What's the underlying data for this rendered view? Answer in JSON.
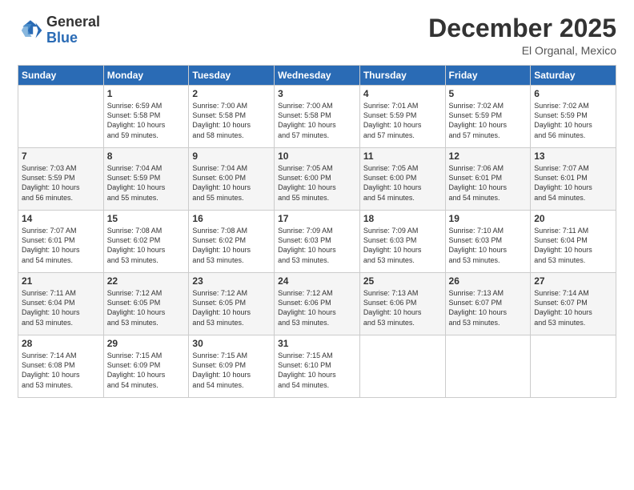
{
  "header": {
    "logo": {
      "line1": "General",
      "line2": "Blue"
    },
    "title": "December 2025",
    "location": "El Organal, Mexico"
  },
  "days_of_week": [
    "Sunday",
    "Monday",
    "Tuesday",
    "Wednesday",
    "Thursday",
    "Friday",
    "Saturday"
  ],
  "weeks": [
    [
      {
        "day": "",
        "info": ""
      },
      {
        "day": "1",
        "info": "Sunrise: 6:59 AM\nSunset: 5:58 PM\nDaylight: 10 hours\nand 59 minutes."
      },
      {
        "day": "2",
        "info": "Sunrise: 7:00 AM\nSunset: 5:58 PM\nDaylight: 10 hours\nand 58 minutes."
      },
      {
        "day": "3",
        "info": "Sunrise: 7:00 AM\nSunset: 5:58 PM\nDaylight: 10 hours\nand 57 minutes."
      },
      {
        "day": "4",
        "info": "Sunrise: 7:01 AM\nSunset: 5:59 PM\nDaylight: 10 hours\nand 57 minutes."
      },
      {
        "day": "5",
        "info": "Sunrise: 7:02 AM\nSunset: 5:59 PM\nDaylight: 10 hours\nand 57 minutes."
      },
      {
        "day": "6",
        "info": "Sunrise: 7:02 AM\nSunset: 5:59 PM\nDaylight: 10 hours\nand 56 minutes."
      }
    ],
    [
      {
        "day": "7",
        "info": "Sunrise: 7:03 AM\nSunset: 5:59 PM\nDaylight: 10 hours\nand 56 minutes."
      },
      {
        "day": "8",
        "info": "Sunrise: 7:04 AM\nSunset: 5:59 PM\nDaylight: 10 hours\nand 55 minutes."
      },
      {
        "day": "9",
        "info": "Sunrise: 7:04 AM\nSunset: 6:00 PM\nDaylight: 10 hours\nand 55 minutes."
      },
      {
        "day": "10",
        "info": "Sunrise: 7:05 AM\nSunset: 6:00 PM\nDaylight: 10 hours\nand 55 minutes."
      },
      {
        "day": "11",
        "info": "Sunrise: 7:05 AM\nSunset: 6:00 PM\nDaylight: 10 hours\nand 54 minutes."
      },
      {
        "day": "12",
        "info": "Sunrise: 7:06 AM\nSunset: 6:01 PM\nDaylight: 10 hours\nand 54 minutes."
      },
      {
        "day": "13",
        "info": "Sunrise: 7:07 AM\nSunset: 6:01 PM\nDaylight: 10 hours\nand 54 minutes."
      }
    ],
    [
      {
        "day": "14",
        "info": "Sunrise: 7:07 AM\nSunset: 6:01 PM\nDaylight: 10 hours\nand 54 minutes."
      },
      {
        "day": "15",
        "info": "Sunrise: 7:08 AM\nSunset: 6:02 PM\nDaylight: 10 hours\nand 53 minutes."
      },
      {
        "day": "16",
        "info": "Sunrise: 7:08 AM\nSunset: 6:02 PM\nDaylight: 10 hours\nand 53 minutes."
      },
      {
        "day": "17",
        "info": "Sunrise: 7:09 AM\nSunset: 6:03 PM\nDaylight: 10 hours\nand 53 minutes."
      },
      {
        "day": "18",
        "info": "Sunrise: 7:09 AM\nSunset: 6:03 PM\nDaylight: 10 hours\nand 53 minutes."
      },
      {
        "day": "19",
        "info": "Sunrise: 7:10 AM\nSunset: 6:03 PM\nDaylight: 10 hours\nand 53 minutes."
      },
      {
        "day": "20",
        "info": "Sunrise: 7:11 AM\nSunset: 6:04 PM\nDaylight: 10 hours\nand 53 minutes."
      }
    ],
    [
      {
        "day": "21",
        "info": "Sunrise: 7:11 AM\nSunset: 6:04 PM\nDaylight: 10 hours\nand 53 minutes."
      },
      {
        "day": "22",
        "info": "Sunrise: 7:12 AM\nSunset: 6:05 PM\nDaylight: 10 hours\nand 53 minutes."
      },
      {
        "day": "23",
        "info": "Sunrise: 7:12 AM\nSunset: 6:05 PM\nDaylight: 10 hours\nand 53 minutes."
      },
      {
        "day": "24",
        "info": "Sunrise: 7:12 AM\nSunset: 6:06 PM\nDaylight: 10 hours\nand 53 minutes."
      },
      {
        "day": "25",
        "info": "Sunrise: 7:13 AM\nSunset: 6:06 PM\nDaylight: 10 hours\nand 53 minutes."
      },
      {
        "day": "26",
        "info": "Sunrise: 7:13 AM\nSunset: 6:07 PM\nDaylight: 10 hours\nand 53 minutes."
      },
      {
        "day": "27",
        "info": "Sunrise: 7:14 AM\nSunset: 6:07 PM\nDaylight: 10 hours\nand 53 minutes."
      }
    ],
    [
      {
        "day": "28",
        "info": "Sunrise: 7:14 AM\nSunset: 6:08 PM\nDaylight: 10 hours\nand 53 minutes."
      },
      {
        "day": "29",
        "info": "Sunrise: 7:15 AM\nSunset: 6:09 PM\nDaylight: 10 hours\nand 54 minutes."
      },
      {
        "day": "30",
        "info": "Sunrise: 7:15 AM\nSunset: 6:09 PM\nDaylight: 10 hours\nand 54 minutes."
      },
      {
        "day": "31",
        "info": "Sunrise: 7:15 AM\nSunset: 6:10 PM\nDaylight: 10 hours\nand 54 minutes."
      },
      {
        "day": "",
        "info": ""
      },
      {
        "day": "",
        "info": ""
      },
      {
        "day": "",
        "info": ""
      }
    ]
  ]
}
